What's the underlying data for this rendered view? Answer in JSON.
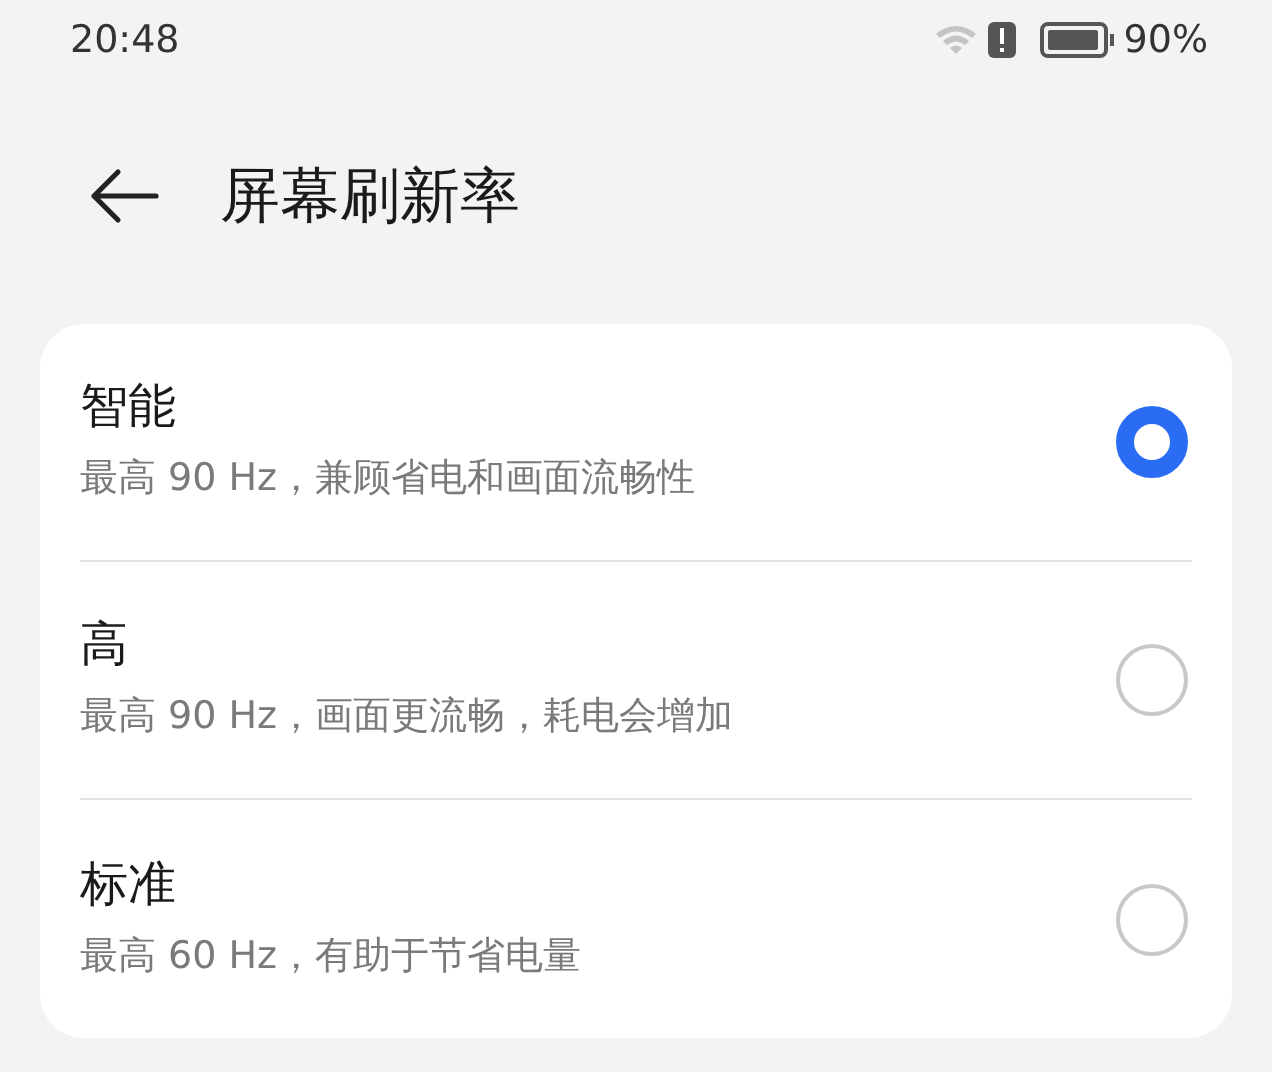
{
  "status_bar": {
    "time": "20:48",
    "battery_percent": "90%"
  },
  "header": {
    "title": "屏幕刷新率"
  },
  "options": [
    {
      "title": "智能",
      "description": "最高 90 Hz，兼顾省电和画面流畅性",
      "selected": true
    },
    {
      "title": "高",
      "description": "最高 90 Hz，画面更流畅，耗电会增加",
      "selected": false
    },
    {
      "title": "标准",
      "description": "最高 60 Hz，有助于节省电量",
      "selected": false
    }
  ]
}
